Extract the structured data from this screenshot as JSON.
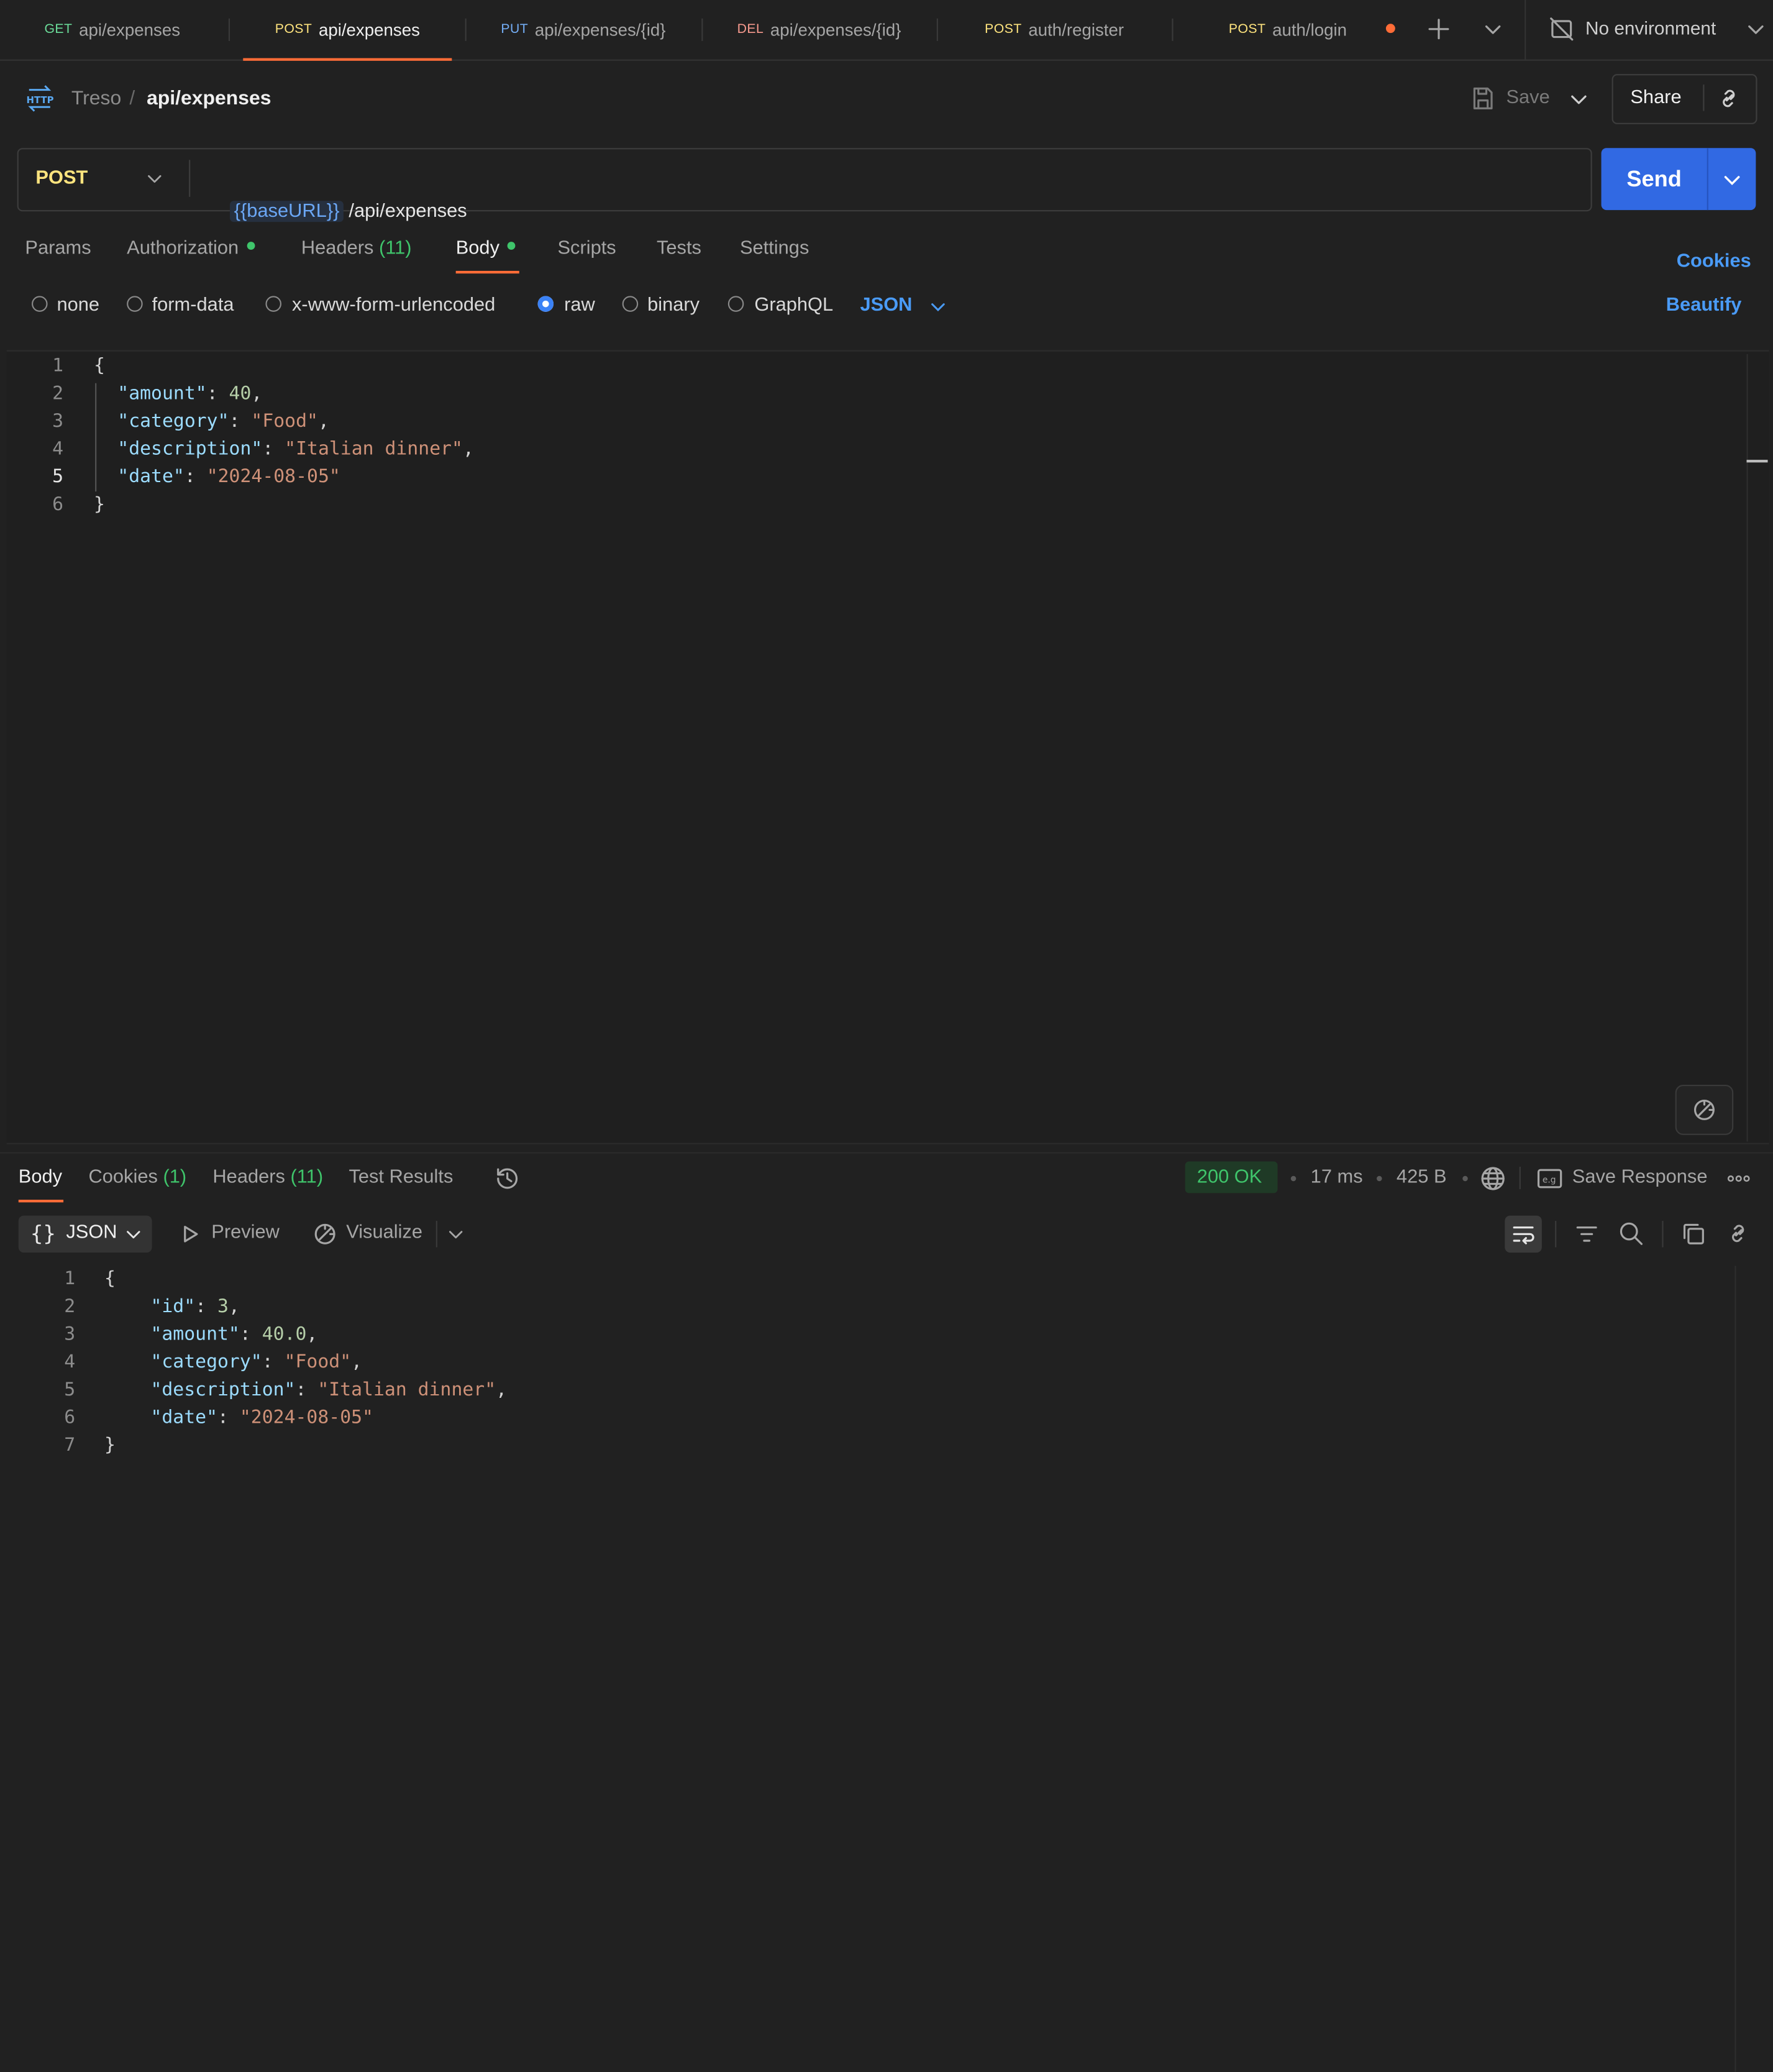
{
  "tabs": [
    {
      "method": "GET",
      "path": "api/expenses",
      "active": false
    },
    {
      "method": "POST",
      "path": "api/expenses",
      "active": true
    },
    {
      "method": "PUT",
      "path": "api/expenses/{id}",
      "active": false
    },
    {
      "method": "DEL",
      "path": "api/expenses/{id}",
      "active": false
    },
    {
      "method": "POST",
      "path": "auth/register",
      "active": false
    },
    {
      "method": "POST",
      "path": "auth/login",
      "active": false,
      "unsaved": true
    }
  ],
  "environment": {
    "label": "No environment"
  },
  "breadcrumb": {
    "workspace": "Treso",
    "separator": "/",
    "request": "api/expenses"
  },
  "actions": {
    "save": "Save",
    "share": "Share"
  },
  "request": {
    "method": "POST",
    "url_variable": "{{baseURL}}",
    "url_path": " /api/expenses",
    "send": "Send"
  },
  "request_tabs": {
    "params": "Params",
    "authorization": "Authorization",
    "headers": "Headers",
    "headers_count": "(11)",
    "body": "Body",
    "scripts": "Scripts",
    "tests": "Tests",
    "settings": "Settings",
    "cookies": "Cookies"
  },
  "body_types": {
    "none": "none",
    "form_data": "form-data",
    "urlencoded": "x-www-form-urlencoded",
    "raw": "raw",
    "binary": "binary",
    "graphql": "GraphQL",
    "selected": "raw",
    "format": "JSON",
    "beautify": "Beautify"
  },
  "request_body": {
    "line_numbers": [
      "1",
      "2",
      "3",
      "4",
      "5",
      "6"
    ],
    "open": "{",
    "close": "}",
    "fields": [
      {
        "key": "\"amount\"",
        "value": "40",
        "comma": ","
      },
      {
        "key": "\"category\"",
        "value": "\"Food\"",
        "comma": ","
      },
      {
        "key": "\"description\"",
        "value": "\"Italian dinner\"",
        "comma": ","
      },
      {
        "key": "\"date\"",
        "value": "\"2024-08-05\"",
        "comma": ""
      }
    ]
  },
  "response_tabs": {
    "body": "Body",
    "cookies": "Cookies",
    "cookies_count": "(1)",
    "headers": "Headers",
    "headers_count": "(11)",
    "test_results": "Test Results"
  },
  "response_meta": {
    "status": "200 OK",
    "time": "17 ms",
    "size": "425 B",
    "save_response": "Save Response"
  },
  "response_view": {
    "format": "JSON",
    "preview": "Preview",
    "visualize": "Visualize"
  },
  "response_body": {
    "line_numbers": [
      "1",
      "2",
      "3",
      "4",
      "5",
      "6",
      "7"
    ],
    "open": "{",
    "close": "}",
    "fields": [
      {
        "key": "\"id\"",
        "value": "3",
        "comma": ","
      },
      {
        "key": "\"amount\"",
        "value": "40.0",
        "comma": ","
      },
      {
        "key": "\"category\"",
        "value": "\"Food\"",
        "comma": ","
      },
      {
        "key": "\"description\"",
        "value": "\"Italian dinner\"",
        "comma": ","
      },
      {
        "key": "\"date\"",
        "value": "\"2024-08-05\"",
        "comma": ""
      }
    ]
  },
  "colors": {
    "accent": "#ff6c37",
    "send": "#3169e3",
    "link": "#4a9bf7",
    "status_ok": "#3fc56b"
  }
}
